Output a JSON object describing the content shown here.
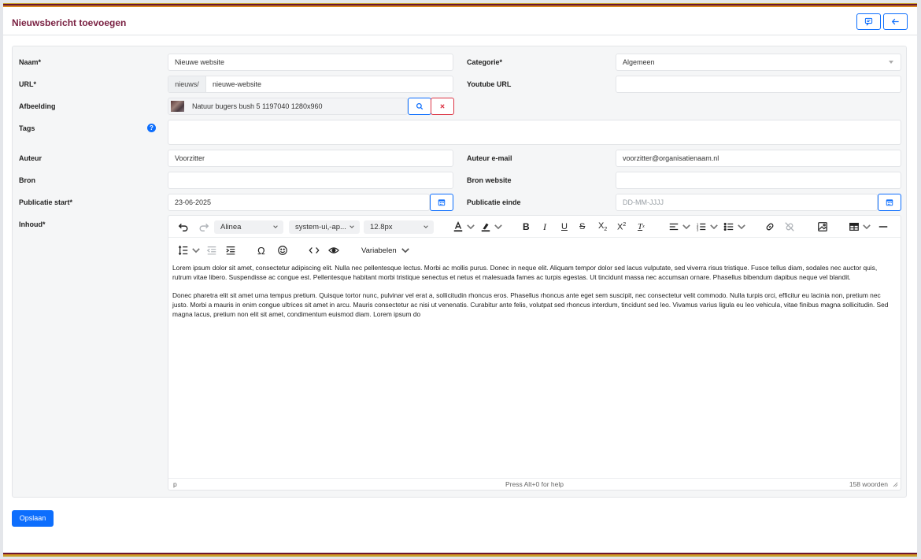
{
  "page": {
    "title": "Nieuwsbericht toevoegen"
  },
  "form": {
    "naam": {
      "label": "Naam*",
      "value": "Nieuwe website"
    },
    "categorie": {
      "label": "Categorie*",
      "value": "Algemeen"
    },
    "url": {
      "label": "URL*",
      "prefix": "nieuws/",
      "value": "nieuwe-website"
    },
    "youtube": {
      "label": "Youtube URL",
      "value": ""
    },
    "afbeelding": {
      "label": "Afbeelding",
      "value": "Natuur bugers bush 5 1197040 1280x960"
    },
    "tags": {
      "label": "Tags",
      "help": "?",
      "value": ""
    },
    "auteur": {
      "label": "Auteur",
      "value": "Voorzitter"
    },
    "auteur_email": {
      "label": "Auteur e-mail",
      "value": "voorzitter@organisatienaam.nl"
    },
    "bron": {
      "label": "Bron",
      "value": ""
    },
    "bron_website": {
      "label": "Bron website",
      "value": ""
    },
    "pub_start": {
      "label": "Publicatie start*",
      "value": "23-06-2025"
    },
    "pub_einde": {
      "label": "Publicatie einde",
      "placeholder": "DD-MM-JJJJ"
    },
    "inhoud": {
      "label": "Inhoud*"
    }
  },
  "editor": {
    "block_format": "Alinea",
    "font_family": "system-ui,-ap...",
    "font_size": "12.8px",
    "variables": "Variabelen",
    "paragraphs": [
      "Lorem ipsum dolor sit amet, consectetur adipiscing elit. Nulla nec pellentesque lectus. Morbi ac mollis purus. Donec in neque elit. Aliquam tempor dolor sed lacus vulputate, sed viverra risus tristique. Fusce tellus diam, sodales nec auctor quis, rutrum vitae libero. Suspendisse ac congue est. Pellentesque habitant morbi tristique senectus et netus et malesuada fames ac turpis egestas. Ut tincidunt massa nec accumsan ornare. Phasellus bibendum dapibus neque vel blandit.",
      "Donec pharetra elit sit amet urna tempus pretium. Quisque tortor nunc, pulvinar vel erat a, sollicitudin rhoncus eros. Phasellus rhoncus ante eget sem suscipit, nec consectetur velit commodo. Nulla turpis orci, efficitur eu lacinia non, pretium nec justo. Morbi a mauris in enim congue ultrices sit amet in arcu. Mauris consectetur ac nisi ut venenatis. Curabitur ante felis, volutpat sed rhoncus interdum, tincidunt sed leo. Vivamus varius ligula eu leo vehicula, vitae finibus magna sollicitudin. Sed magna lacus, pretium non elit sit amet, condimentum euismod diam. Lorem ipsum do"
    ],
    "status_path": "p",
    "status_help": "Press Alt+0 for help",
    "word_count": "158 woorden"
  },
  "actions": {
    "save": "Opslaan"
  },
  "colors": {
    "accent": "#0d6efd",
    "title": "#7a2142",
    "danger": "#dc3545"
  }
}
